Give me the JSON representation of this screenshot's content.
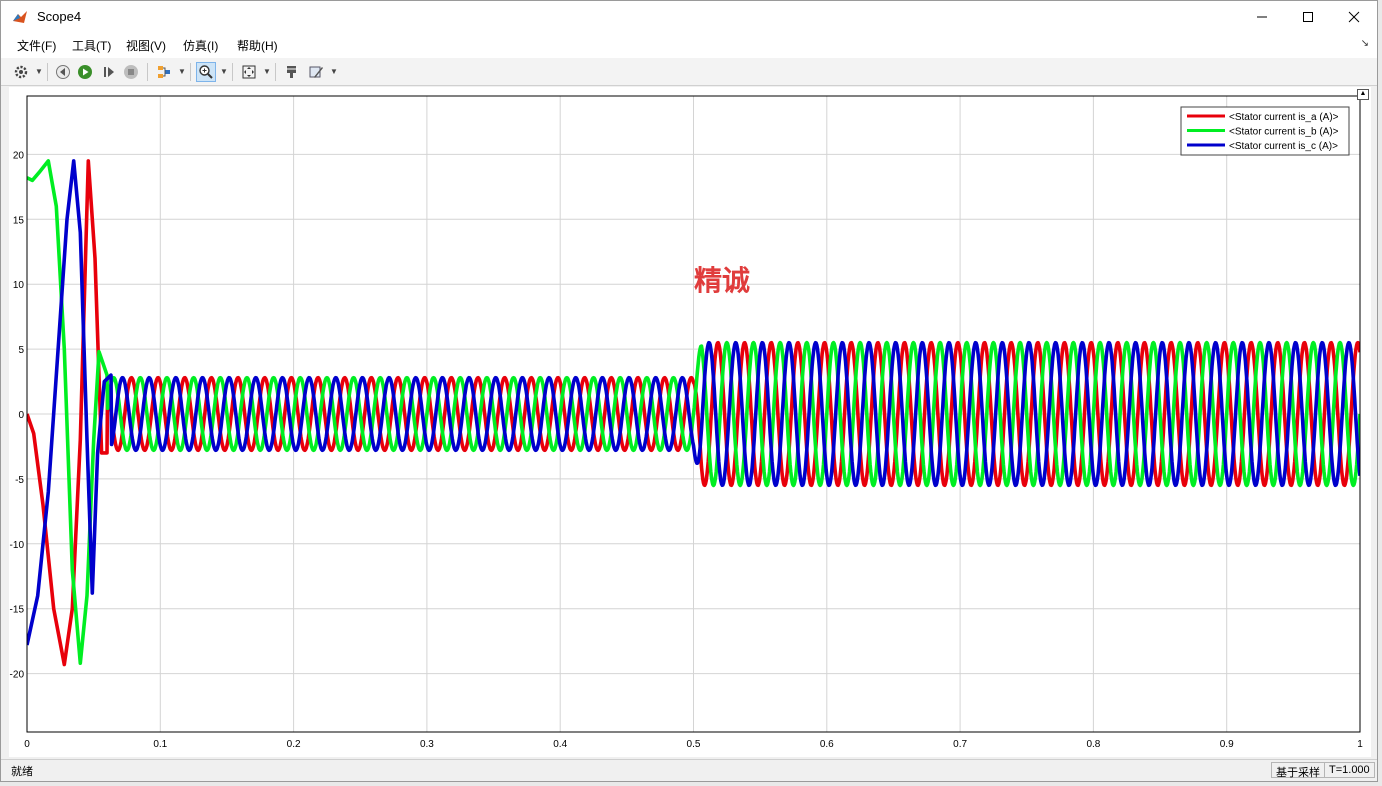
{
  "window": {
    "title": "Scope4"
  },
  "menu": [
    "文件(F)",
    "工具(T)",
    "视图(V)",
    "仿真(I)",
    "帮助(H)"
  ],
  "toolbar": {
    "icons": [
      "settings-gear-icon",
      "step-back-icon",
      "run-icon",
      "step-forward-icon",
      "stop-icon",
      "signal-selector-icon",
      "zoom-icon",
      "autoscale-icon",
      "highlight-icon",
      "style-icon"
    ]
  },
  "watermark": "精诚",
  "status": {
    "left": "就绪",
    "mode": "基于采样",
    "time": "T=1.000"
  },
  "colors": {
    "phase_a": "#e8000b",
    "phase_b": "#00ee22",
    "phase_c": "#0000cc",
    "grid": "#d4d4d4",
    "watermark": "#e03c3c"
  },
  "chart_data": {
    "type": "line",
    "xlim": [
      0,
      1
    ],
    "ylim": [
      -24.5,
      24.5
    ],
    "xticks": [
      0,
      0.1,
      0.2,
      0.3,
      0.4,
      0.5,
      0.6,
      0.7,
      0.8,
      0.9,
      1
    ],
    "yticks": [
      -20,
      -15,
      -10,
      -5,
      0,
      5,
      10,
      15,
      20
    ],
    "grid": true,
    "legend_position": "top-right",
    "model_note": "startup transient to ~0.06 s, steady amplitude 2.8 A, step to 5.5 A at t=0.5 s, approx 50 Hz",
    "series": [
      {
        "name": "<Stator current is_a (A)>",
        "color": "#e8000b",
        "transient": [
          [
            0,
            0
          ],
          [
            0.005,
            -1.5
          ],
          [
            0.012,
            -7
          ],
          [
            0.02,
            -15
          ],
          [
            0.028,
            -19.3
          ],
          [
            0.034,
            -15
          ],
          [
            0.04,
            -2
          ],
          [
            0.046,
            19.5
          ],
          [
            0.051,
            12
          ],
          [
            0.056,
            -3
          ],
          [
            0.06,
            -3
          ]
        ],
        "steady": {
          "start": 0.06,
          "phase_deg": 120
        }
      },
      {
        "name": "<Stator current is_b (A)>",
        "color": "#00ee22",
        "transient": [
          [
            0,
            18.2
          ],
          [
            0.004,
            18
          ],
          [
            0.009,
            18.6
          ],
          [
            0.016,
            19.5
          ],
          [
            0.022,
            16
          ],
          [
            0.028,
            5
          ],
          [
            0.034,
            -12
          ],
          [
            0.04,
            -19.2
          ],
          [
            0.045,
            -14
          ],
          [
            0.05,
            -2
          ],
          [
            0.054,
            4.8
          ],
          [
            0.06,
            3
          ]
        ],
        "steady": {
          "start": 0.06,
          "phase_deg": 0
        }
      },
      {
        "name": "<Stator current is_c (A)>",
        "color": "#0000cc",
        "transient": [
          [
            0,
            -17.8
          ],
          [
            0.008,
            -14
          ],
          [
            0.016,
            -6
          ],
          [
            0.024,
            6
          ],
          [
            0.03,
            15
          ],
          [
            0.035,
            19.5
          ],
          [
            0.04,
            14
          ],
          [
            0.045,
            -2
          ],
          [
            0.049,
            -13.8
          ],
          [
            0.053,
            -3
          ],
          [
            0.058,
            2.5
          ],
          [
            0.063,
            3
          ]
        ],
        "steady": {
          "start": 0.063,
          "phase_deg": 240
        }
      }
    ],
    "steady_amplitude": [
      2.8,
      5.5
    ],
    "step_time": 0.5,
    "frequency_hz": 50
  }
}
